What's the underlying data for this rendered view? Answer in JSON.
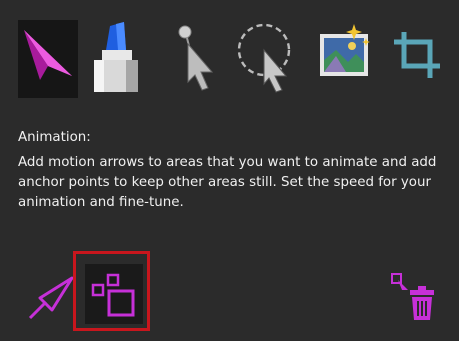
{
  "description": {
    "heading": "Animation:",
    "body": "Add motion arrows to areas that you want to animate and add anchor points to keep other areas still. Set the speed for your animation and fine-tune."
  },
  "tools": [
    {
      "icon": "motion-arrow-tool-icon",
      "selected": true
    },
    {
      "icon": "eraser-tool-icon",
      "selected": false
    },
    {
      "icon": "anchor-point-tool-icon",
      "selected": false
    },
    {
      "icon": "selection-tool-icon",
      "selected": false
    },
    {
      "icon": "sky-overlay-icon",
      "selected": false
    },
    {
      "icon": "crop-icon",
      "selected": false
    }
  ],
  "bottom_tools": [
    {
      "icon": "add-motion-arrow-icon"
    },
    {
      "icon": "select-multiple-icon",
      "highlighted": true
    },
    {
      "icon": "delete-selection-icon"
    }
  ],
  "colors": {
    "background": "#2b2b2b",
    "accent": "#c630d8",
    "highlight": "#c8161d",
    "text": "#f0f0f0"
  }
}
